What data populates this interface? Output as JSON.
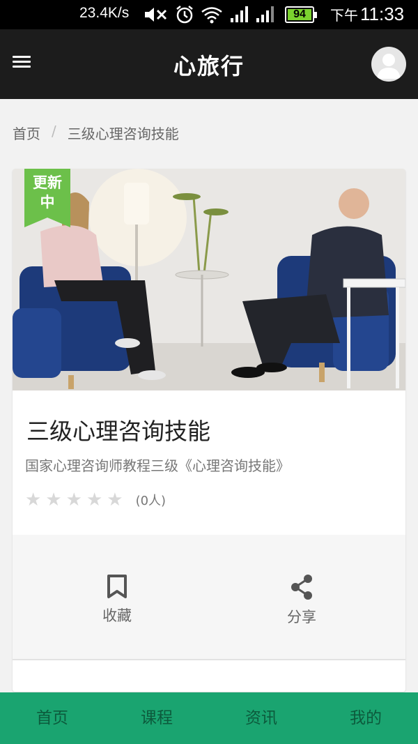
{
  "status_bar": {
    "net_speed": "23.4K/s",
    "battery": "94",
    "ampm": "下午",
    "time": "11:33",
    "icons": [
      "mute-icon",
      "alarm-icon",
      "wifi-icon",
      "signal-icon",
      "signal-icon",
      "battery-icon"
    ]
  },
  "app_bar": {
    "title": "心旅行",
    "menu_icon": "hamburger-menu-icon",
    "avatar_icon": "user-avatar-icon"
  },
  "breadcrumb": {
    "home": "首页",
    "separator": "/",
    "current": "三级心理咨询技能"
  },
  "course": {
    "badge": "更新\n中",
    "title": "三级心理咨询技能",
    "description": "国家心理咨询师教程三级《心理咨询技能》",
    "rating_stars": 0,
    "rating_count": "(0人)"
  },
  "actions": {
    "collect_label": "收藏",
    "share_label": "分享"
  },
  "bottom_nav": [
    {
      "label": "首页"
    },
    {
      "label": "课程"
    },
    {
      "label": "资讯"
    },
    {
      "label": "我的"
    }
  ],
  "colors": {
    "header_bg": "#1c1c1c",
    "nav_bg": "#1aa470",
    "nav_text": "#0c5a3c",
    "badge_bg": "#6cc04a",
    "star_empty": "#d8d8d8"
  }
}
